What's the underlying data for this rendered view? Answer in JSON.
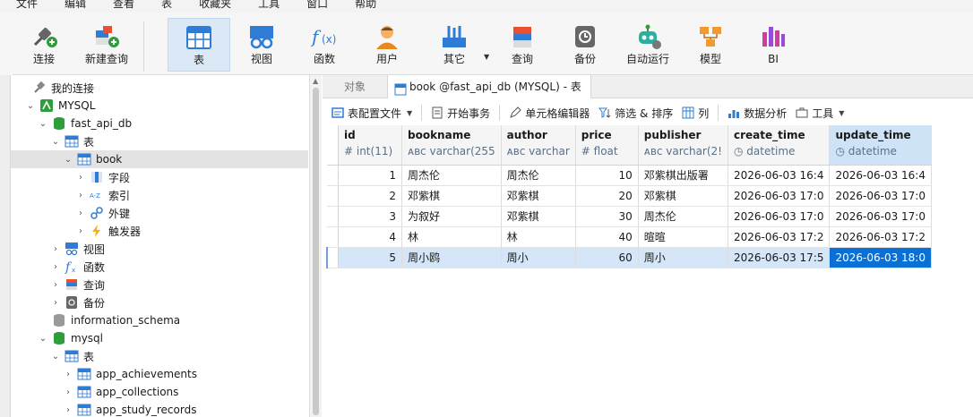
{
  "menu": [
    "文件",
    "编辑",
    "查看",
    "表",
    "收藏夹",
    "工具",
    "窗口",
    "帮助"
  ],
  "toolbar": {
    "items": [
      {
        "label": "连接",
        "icon": "connect-icon"
      },
      {
        "label": "新建查询",
        "icon": "new-query-icon"
      },
      {
        "label": "表",
        "icon": "table-icon"
      },
      {
        "label": "视图",
        "icon": "view-icon"
      },
      {
        "label": "函数",
        "icon": "function-icon"
      },
      {
        "label": "用户",
        "icon": "user-icon"
      },
      {
        "label": "其它",
        "icon": "other-icon"
      },
      {
        "label": "查询",
        "icon": "query-icon"
      },
      {
        "label": "备份",
        "icon": "backup-icon"
      },
      {
        "label": "自动运行",
        "icon": "robot-icon"
      },
      {
        "label": "模型",
        "icon": "model-icon"
      },
      {
        "label": "BI",
        "icon": "bi-icon"
      }
    ]
  },
  "nav": {
    "items": [
      {
        "label": "我的连接",
        "level": 0,
        "arrow": "",
        "icon": "connections-icon"
      },
      {
        "label": "MYSQL",
        "level": 1,
        "arrow": "⌄",
        "icon": "mysql-icon"
      },
      {
        "label": "fast_api_db",
        "level": 2,
        "arrow": "⌄",
        "icon": "database-icon"
      },
      {
        "label": "表",
        "level": 3,
        "arrow": "⌄",
        "icon": "table-folder-icon"
      },
      {
        "label": "book",
        "level": 4,
        "arrow": "⌄",
        "icon": "table-icon"
      },
      {
        "label": "字段",
        "level": 5,
        "arrow": "›",
        "icon": "fields-icon"
      },
      {
        "label": "索引",
        "level": 5,
        "arrow": "›",
        "icon": "index-icon"
      },
      {
        "label": "外键",
        "level": 5,
        "arrow": "›",
        "icon": "foreign-key-icon"
      },
      {
        "label": "触发器",
        "level": 5,
        "arrow": "›",
        "icon": "trigger-icon"
      },
      {
        "label": "视图",
        "level": 3,
        "arrow": "›",
        "icon": "view-icon"
      },
      {
        "label": "函数",
        "level": 3,
        "arrow": "›",
        "icon": "function-icon"
      },
      {
        "label": "查询",
        "level": 3,
        "arrow": "›",
        "icon": "query-icon"
      },
      {
        "label": "备份",
        "level": 3,
        "arrow": "›",
        "icon": "backup-icon"
      },
      {
        "label": "information_schema",
        "level": 2,
        "arrow": "",
        "icon": "database-grey-icon"
      },
      {
        "label": "mysql",
        "level": 2,
        "arrow": "⌄",
        "icon": "database-icon"
      },
      {
        "label": "表",
        "level": 3,
        "arrow": "⌄",
        "icon": "table-folder-icon"
      },
      {
        "label": "app_achievements",
        "level": 4,
        "arrow": "›",
        "icon": "table-icon"
      },
      {
        "label": "app_collections",
        "level": 4,
        "arrow": "›",
        "icon": "table-icon"
      },
      {
        "label": "app_study_records",
        "level": 4,
        "arrow": "›",
        "icon": "table-icon"
      }
    ]
  },
  "tabs": {
    "objects": "对象",
    "active": "book @fast_api_db (MYSQL) - 表"
  },
  "subtoolbar": {
    "config": "表配置文件",
    "transaction": "开始事务",
    "cell_editor": "单元格编辑器",
    "filter_sort": "筛选 & 排序",
    "columns": "列",
    "analysis": "数据分析",
    "tools": "工具"
  },
  "grid": {
    "columns": [
      {
        "name": "id",
        "type": "# int(11)"
      },
      {
        "name": "bookname",
        "type": "ᴀʙc varchar(255"
      },
      {
        "name": "author",
        "type": "ᴀʙc varchar"
      },
      {
        "name": "price",
        "type": "# float"
      },
      {
        "name": "publisher",
        "type": "ᴀʙc varchar(2!"
      },
      {
        "name": "create_time",
        "type": "◷ datetime"
      },
      {
        "name": "update_time",
        "type": "◷ datetime"
      }
    ],
    "rows": [
      [
        "1",
        "周杰伦",
        "周杰伦",
        "10",
        "邓紫棋出版署",
        "2026-06-03 16:4",
        "2026-06-03 16:4"
      ],
      [
        "2",
        "邓紫棋",
        "邓紫棋",
        "20",
        "邓紫棋",
        "2026-06-03 17:0",
        "2026-06-03 17:0"
      ],
      [
        "3",
        "为叙好",
        "邓紫棋",
        "30",
        "周杰伦",
        "2026-06-03 17:0",
        "2026-06-03 17:0"
      ],
      [
        "4",
        "林",
        "林",
        "40",
        "暄暄",
        "2026-06-03 17:2",
        "2026-06-03 17:2"
      ],
      [
        "5",
        "周小鸥",
        "周小",
        "60",
        "周小",
        "2026-06-03 17:5",
        "2026-06-03 18:0"
      ]
    ],
    "selected_row": 4
  },
  "colors": {
    "accent": "#0a70d6",
    "selection": "#d4e6f7",
    "toolbar_active": "#dbe9f7"
  }
}
